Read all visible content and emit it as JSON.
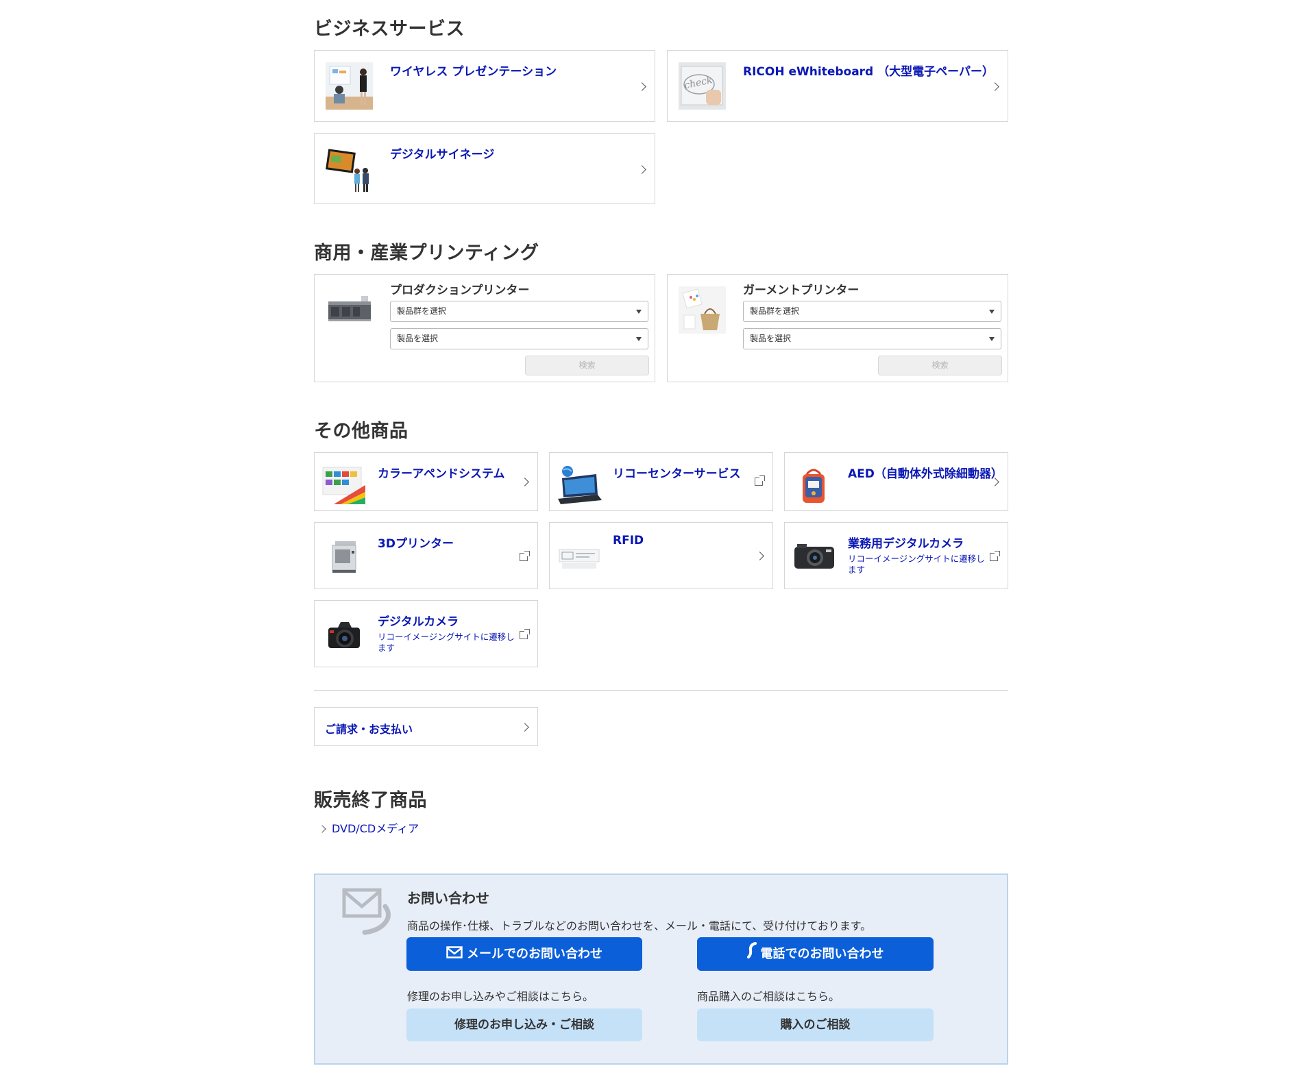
{
  "sections": {
    "business": {
      "title": "ビジネスサービス",
      "items": [
        {
          "label": "ワイヤレス プレゼンテーション",
          "icon": "chevron-right-icon"
        },
        {
          "label": "RICOH eWhiteboard （大型電子ペーパー）",
          "icon": "chevron-right-icon"
        },
        {
          "label": "デジタルサイネージ",
          "icon": "chevron-right-icon"
        }
      ]
    },
    "printing": {
      "title": "商用・産業プリンティング",
      "items": [
        {
          "label": "プロダクションプリンター",
          "select_group": "製品群を選択",
          "select_product": "製品を選択",
          "search": "検索"
        },
        {
          "label": "ガーメントプリンター",
          "select_group": "製品群を選択",
          "select_product": "製品を選択",
          "search": "検索"
        }
      ]
    },
    "other": {
      "title": "その他商品",
      "items": [
        {
          "label": "カラーアペンドシステム",
          "icon": "chevron-right-icon"
        },
        {
          "label": "リコーセンターサービス",
          "icon": "external-link-icon"
        },
        {
          "label": "AED（自動体外式除細動器）",
          "icon": "chevron-right-icon"
        },
        {
          "label": "3Dプリンター",
          "icon": "external-link-icon"
        },
        {
          "label": "RFID",
          "icon": "chevron-right-icon"
        },
        {
          "label": "業務用デジタルカメラ",
          "sub": "リコーイメージングサイトに遷移します",
          "icon": "external-link-icon"
        },
        {
          "label": "デジタルカメラ",
          "sub": "リコーイメージングサイトに遷移します",
          "icon": "external-link-icon"
        }
      ]
    },
    "billing": {
      "label": "ご請求・お支払い"
    },
    "discontinued": {
      "title": "販売終了商品",
      "links": [
        "DVD/CDメディア"
      ]
    }
  },
  "contact": {
    "title": "お問い合わせ",
    "description": "商品の操作･仕様、トラブルなどのお問い合わせを、メール・電話にて、受け付けております。",
    "mail_button": "メールでのお問い合わせ",
    "phone_button": "電話でのお問い合わせ",
    "repair_note": "修理のお申し込みやご相談はこちら。",
    "repair_button": "修理のお申し込み・ご相談",
    "purchase_note": "商品購入のご相談はこちら。",
    "purchase_button": "購入のご相談",
    "colors": {
      "primary": "#0b5fd9",
      "light": "#c5e1f7",
      "panel_bg": "#e8eef8",
      "link": "#0a17b4"
    }
  }
}
